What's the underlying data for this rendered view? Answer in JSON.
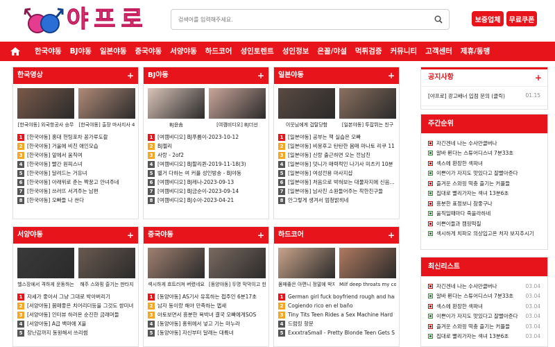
{
  "header": {
    "logo_text": "야프로",
    "search_placeholder": "검색어를 입력해주세요.",
    "btn_verified": "보증업체",
    "btn_coupon": "무료쿠폰"
  },
  "nav": [
    "한국야동",
    "BJ야동",
    "일본야동",
    "중국야동",
    "서양야동",
    "하드코어",
    "성인토렌트",
    "성인정보",
    "은꼴/야설",
    "먹튀검증",
    "커뮤니티",
    "고객센터",
    "제휴/동맹"
  ],
  "sections": [
    {
      "title": "한국영상",
      "thumbs": [
        "[한국야동] 외국항공사 승무",
        "[한국야동] 출장 마사지사 4"
      ],
      "items": [
        "[한국야동] 홍대 헌팅포차 꽁가루도촬",
        "[한국야동] 거울에 비친 애인모습",
        "[한국야동] 앞에서 움직여",
        "[한국야동] 빨간 원피스녀",
        "[한국야동] 달려드는 거유녀",
        "[한국야동] 아래위로 춘는 짝꿍고 안녀주네",
        "[한국야동] 쓰러뜨 서겨주는 남편",
        "[한국야동] 오빠들 나 싼다"
      ]
    },
    {
      "title": "BJ야동",
      "thumbs": [
        "BJ윤솜",
        "[여캠비디오] BJ더선"
      ],
      "items": [
        "[여캠비디오] BJ푸름이-2023-10-12",
        "BJ젤리",
        "사랑 - 2of2",
        "[여캠비디오] BJ할리퀸-2019-11-18(3)",
        "별거 다하는 여 커플 성인방송 - BJ야동",
        "[여캠비디오] BJ레나-2023-09-13",
        "[여캠비디오] BJ금순이-2023-09-14",
        "[여캠비디오] BJ수아-2023-04-21"
      ]
    },
    {
      "title": "일본야동",
      "thumbs": [
        "이웃님에게 겁탈당함",
        "[일본야동] 투잡뛰는 친구"
      ],
      "items": [
        "[일본야동] 공부는 책 실습은 오빠",
        "[일본야동] 비몽후고 탄탄한 몸매 마나토 리쿠 11...",
        "[일본야동] 신랑 출근하면 오는 전남친",
        "[일본야동] 덧니가 매력적인 나기사 미츠키 10분",
        "[일본야동] 여성전용 마사지샵",
        "[일본야동] 처음으로 박혀보는 대물자지에 신음...",
        "[일본야동] 남사친 소원들어주는 착한친구들",
        "안그렇게 생겨서 엄청밝히네"
      ]
    },
    {
      "title": "서양야동",
      "thumbs": [
        "헬스장에서 격하게 운동하는",
        "해주 스와핑 즐기는 판타지"
      ],
      "items": [
        "자세가 좋아서 그냥 그대로 박아버리기",
        "[서양야동] 몸매좋은 치어리더등을 그것도 쌍미녀",
        "[서양야동] 인터뷰 하러온 순진한 금래머들",
        "[서양야동] A급 백마에 X을",
        "장난감까지 동원해서 쓰리썸"
      ]
    },
    {
      "title": "중국야동",
      "thumbs": [
        "섹시하게 흐트러져 버렸네요",
        "[동양야동] 두명 막막이고 한"
      ],
      "items": [
        "[동양야동] AS기사 유혹하는 접주인 6분17초",
        "남자 동이랑 해야 만족하는 앱새",
        "아토보면서 흥분한 욕박녀 결국 오빠에게SOS",
        "[동양야동] 홍위에서 넣고 기는 마누라",
        "[동양야동] 자신부터 달래는 대륙녀"
      ]
    },
    {
      "title": "하드코어",
      "thumbs": [
        "몸매좋은 아편니 정말에 박지",
        "Milf deep throats my cock"
      ],
      "items": [
        "German girl fuck boyfriend rough and har...",
        "Cogiendo rico en el baño",
        "Tiny Tits Teen Rides a Sex Machine Hard t...",
        "드럼링 항문",
        "ExxxtraSmall - Pretty Blonde Teen Gets S..."
      ]
    }
  ],
  "sidebar": {
    "notice_title": "공지사항",
    "notice_item": "[야프로] 광고배너 입점 문의 (클릭)",
    "notice_date": "01.15",
    "weekly_title": "주간순위",
    "weekly": [
      "자긴겐네 나는 수사만클버나",
      "알바 뛴다는 스튜어디스녀 7분33초",
      "섹스에 환장한 섹파녀",
      "이쁜이가 자지도 맛있다고 잘빨아준다",
      "즐겨운 스와핑 떡충 즐기는 커플들",
      "집대로 빨리가자는 섹녀 13분6초",
      "흥분한 표정보니 참좋구나",
      "울직일때마다 죽을라하네",
      "이쁜이들과 캠핑떡질",
      "섹시하게 치파오 의상입고온 처자 보지추시기"
    ],
    "latest_title": "최신리스트",
    "latest": [
      {
        "t": "자긴겐네 나는 수사만클버나",
        "d": "03.04"
      },
      {
        "t": "알바 뛴다는 스튜어디스녀 7분33초",
        "d": "03.04"
      },
      {
        "t": "섹스에 환장한 섹파녀",
        "d": "03.04"
      },
      {
        "t": "이쁜이가 자지도 맛있다고 잘빨아준다",
        "d": "03.04"
      },
      {
        "t": "즐겨운 스와핑 떡충 즐기는 커플들",
        "d": "03.04"
      },
      {
        "t": "집대로 빨리가자는 섹녀 13분6초",
        "d": "03.04"
      }
    ]
  }
}
